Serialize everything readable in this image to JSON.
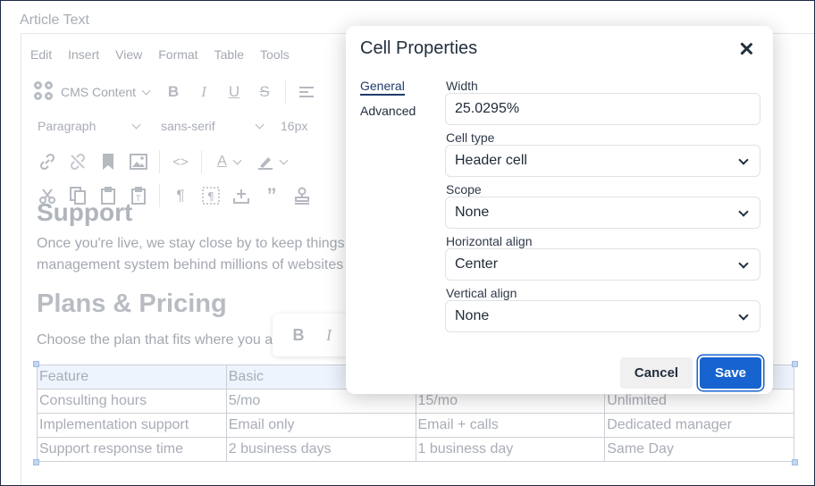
{
  "article_label": "Article Text",
  "menubar": [
    "Edit",
    "Insert",
    "View",
    "Format",
    "Table",
    "Tools"
  ],
  "toolbar": {
    "cms_content": "CMS Content",
    "block_format": "Paragraph",
    "font_family": "sans-serif",
    "font_size": "16px"
  },
  "content": {
    "support_heading": "Support",
    "support_para_line1": "Once you're live, we stay close by to keep things",
    "support_para_line2": "management system behind millions of websites",
    "plans_heading": "Plans & Pricing",
    "plans_para": "Choose the plan that fits where you a",
    "float_bold": "B",
    "float_italic": "I"
  },
  "table": {
    "rows": [
      [
        "Feature",
        "Basic",
        "",
        ""
      ],
      [
        "Consulting hours",
        "5/mo",
        "15/mo",
        "Unlimited"
      ],
      [
        "Implementation support",
        "Email only",
        "Email + calls",
        "Dedicated manager"
      ],
      [
        "Support response time",
        "2 business days",
        "1 business day",
        "Same Day"
      ]
    ]
  },
  "dialog": {
    "title": "Cell Properties",
    "tabs": [
      "General",
      "Advanced"
    ],
    "width_label": "Width",
    "width_value": "25.0295%",
    "cell_type_label": "Cell type",
    "cell_type_value": "Header cell",
    "scope_label": "Scope",
    "scope_value": "None",
    "halign_label": "Horizontal align",
    "halign_value": "Center",
    "valign_label": "Vertical align",
    "valign_value": "None",
    "cancel": "Cancel",
    "save": "Save"
  },
  "colors": {
    "primary": "#1763cf",
    "text_dark": "#222f3e",
    "muted": "#a8adb5"
  }
}
